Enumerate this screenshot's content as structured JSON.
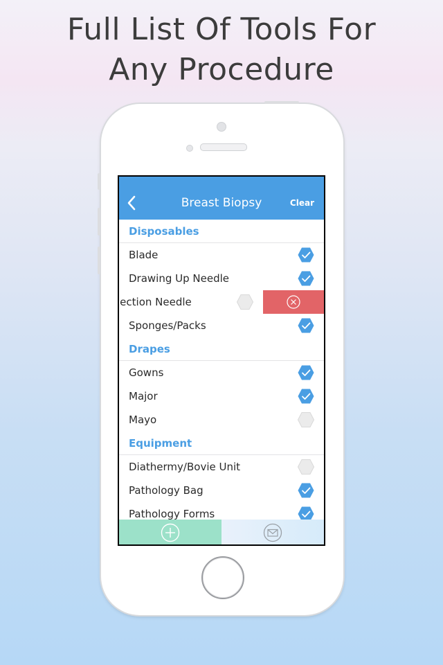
{
  "headline": {
    "line1": "Full List Of Tools For",
    "line2": "Any Procedure"
  },
  "nav": {
    "title": "Breast Biopsy",
    "clear_label": "Clear",
    "back_icon": "chevron-left-icon"
  },
  "colors": {
    "nav_bg": "#4a9ee3",
    "section_text": "#4a9ee3",
    "checked": "#4a9ee3",
    "unchecked": "#ebebeb",
    "delete_bg": "#e26467",
    "add_bg": "#9ce1c9"
  },
  "sections": [
    {
      "title": "Disposables",
      "items": [
        {
          "label": "Blade",
          "checked": true
        },
        {
          "label": "Drawing Up Needle",
          "checked": true
        },
        {
          "label": "jection Needle",
          "checked": false,
          "swiped": true
        },
        {
          "label": "Sponges/Packs",
          "checked": true
        }
      ]
    },
    {
      "title": "Drapes",
      "items": [
        {
          "label": "Gowns",
          "checked": true
        },
        {
          "label": "Major",
          "checked": true
        },
        {
          "label": "Mayo",
          "checked": false
        }
      ]
    },
    {
      "title": "Equipment",
      "items": [
        {
          "label": "Diathermy/Bovie Unit",
          "checked": false
        },
        {
          "label": "Pathology Bag",
          "checked": true
        },
        {
          "label": "Pathology Forms",
          "checked": true
        }
      ]
    }
  ],
  "toolbar": {
    "add_icon": "add-circle-icon",
    "mail_icon": "mail-icon"
  }
}
